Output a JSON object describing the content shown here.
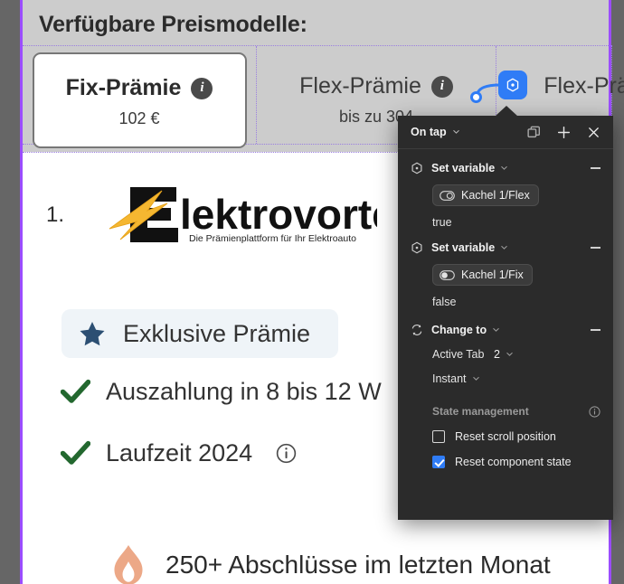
{
  "canvas": {
    "section_title": "Verfügbare Preismodelle:",
    "tabs": [
      {
        "title": "Fix-Prämie",
        "info_icon": "info-icon",
        "subtitle": "102 €",
        "selected": true
      },
      {
        "title": "Flex-Prämie",
        "info_icon": "info-icon",
        "subtitle": "bis zu 304",
        "selected": false
      },
      {
        "title": "Flex-Prä",
        "info_icon": "",
        "subtitle": "",
        "selected": false
      }
    ],
    "list_number": "1.",
    "logo": {
      "wordmark": "lektrovorteil",
      "tagline": "Die Prämienplattform für Ihr Elektroauto",
      "bolt_color": "#f5b731",
      "text_color": "#111111"
    },
    "exclusive_badge": {
      "icon": "star-icon",
      "label": "Exklusive Prämie",
      "bg": "#eff4f8",
      "icon_color": "#2c4f73"
    },
    "bullets": [
      {
        "icon": "check-icon",
        "text": "Auszahlung in 8 bis 12 W",
        "has_info": false
      },
      {
        "icon": "check-icon",
        "text": "Laufzeit 2024",
        "has_info": true
      }
    ],
    "promo": {
      "icon": "flame-icon",
      "text": "250+ Abschlüsse im letzten Monat",
      "icon_color": "#eca887"
    }
  },
  "node": {
    "chip_icon": "component-node-icon",
    "accent": "#2f7cf6"
  },
  "popup": {
    "trigger": "On tap",
    "trigger_chevron": "chevron-down-icon",
    "header_actions": [
      {
        "name": "duplicate-icon",
        "label": "Duplicate"
      },
      {
        "name": "plus-icon",
        "label": "Add action"
      },
      {
        "name": "close-icon",
        "label": "Close"
      }
    ],
    "actions": [
      {
        "icon": "set-variable-icon",
        "title": "Set variable",
        "chevron": "chevron-down-icon",
        "collapse": "minus-icon",
        "variable": "Kachel 1/Flex",
        "variable_icon": "toggle-off-icon",
        "value": "true"
      },
      {
        "icon": "set-variable-icon",
        "title": "Set variable",
        "chevron": "chevron-down-icon",
        "collapse": "minus-icon",
        "variable": "Kachel 1/Fix",
        "variable_icon": "toggle-on-icon",
        "value": "false"
      },
      {
        "icon": "change-to-icon",
        "title": "Change to",
        "chevron": "chevron-down-icon",
        "collapse": "minus-icon",
        "target_key": "Active Tab",
        "target_value": "2",
        "target_chevron": "chevron-down-icon",
        "animation": "Instant",
        "animation_chevron": "chevron-down-icon"
      }
    ],
    "state_management": {
      "label": "State management",
      "info_icon": "info-circle-icon",
      "options": [
        {
          "label": "Reset scroll position",
          "checked": false
        },
        {
          "label": "Reset component state",
          "checked": true
        }
      ]
    },
    "bg": "#2b2b2b",
    "accent": "#2f7cf6"
  }
}
